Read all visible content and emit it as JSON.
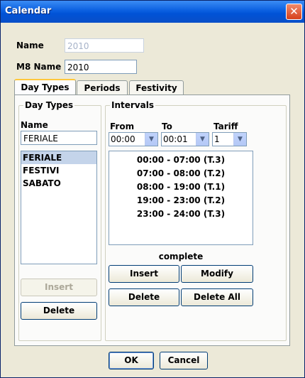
{
  "window": {
    "title": "Calendar",
    "close_glyph": "✕"
  },
  "form": {
    "name_label": "Name",
    "name_value": "2010",
    "m8name_label": "M8 Name",
    "m8name_value": "2010"
  },
  "tabs": [
    {
      "label": "Day Types"
    },
    {
      "label": "Periods"
    },
    {
      "label": "Festivity"
    }
  ],
  "day_types": {
    "group_title": "Day Types",
    "name_label": "Name",
    "name_value": "FERIALE",
    "items": [
      "FERIALE",
      "FESTIVI",
      "SABATO"
    ],
    "selected_index": 0,
    "insert_label": "Insert",
    "delete_label": "Delete"
  },
  "intervals": {
    "group_title": "Intervals",
    "from_label": "From",
    "to_label": "To",
    "tariff_label": "Tariff",
    "from_value": "00:00",
    "to_value": "00:01",
    "tariff_value": "1",
    "items": [
      "00:00 - 07:00  (T.3)",
      "07:00 - 08:00  (T.2)",
      "08:00 - 19:00  (T.1)",
      "19:00 - 23:00  (T.2)",
      "23:00 - 24:00  (T.3)"
    ],
    "status": "complete",
    "insert_label": "Insert",
    "modify_label": "Modify",
    "delete_label": "Delete",
    "delete_all_label": "Delete All"
  },
  "footer": {
    "ok_label": "OK",
    "cancel_label": "Cancel"
  }
}
